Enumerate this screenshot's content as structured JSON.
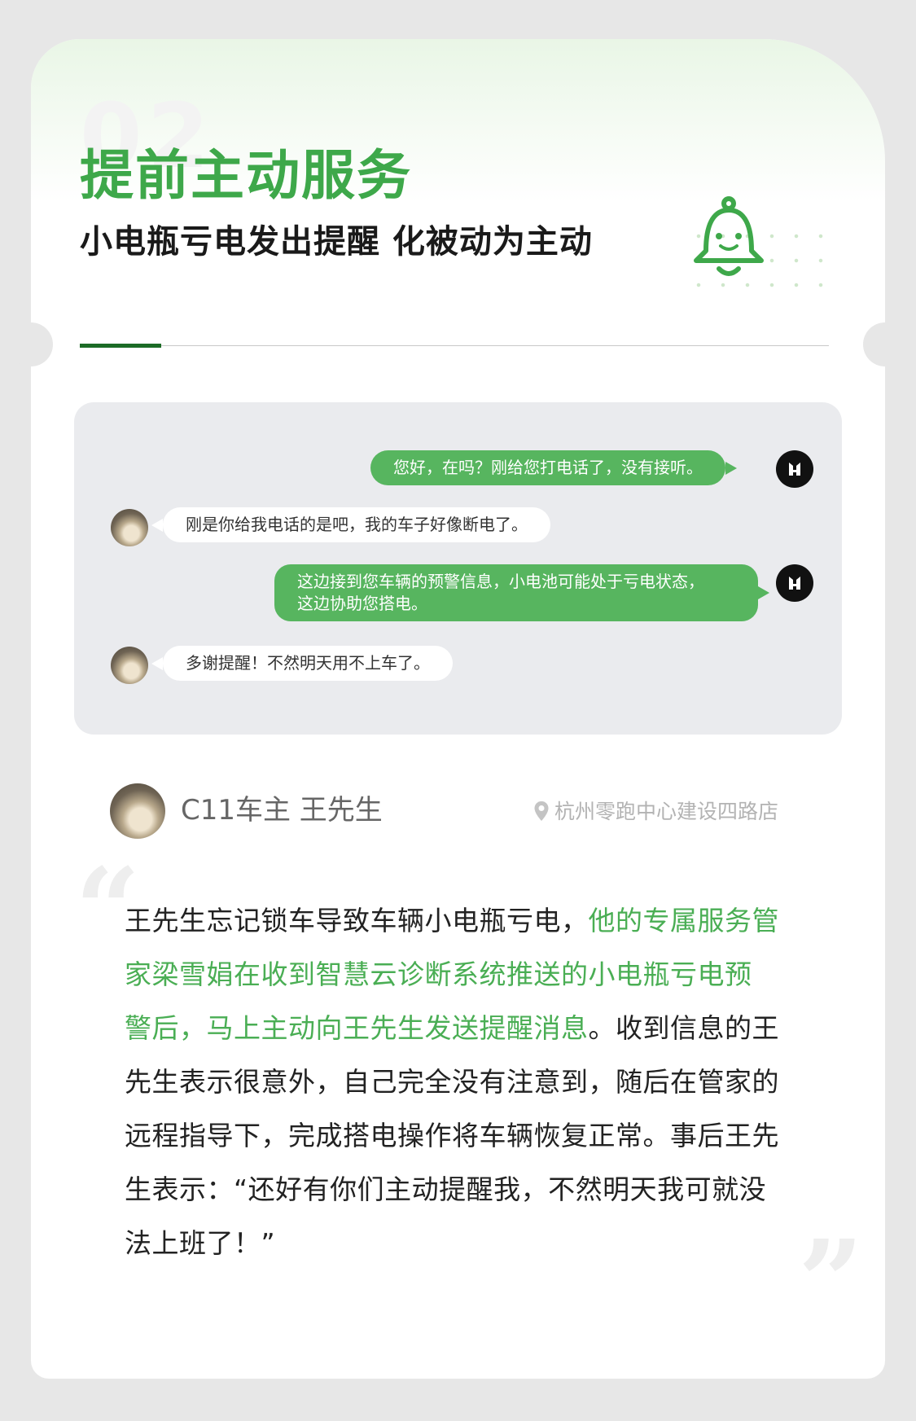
{
  "header": {
    "section_number": "02",
    "title": "提前主动服务",
    "subtitle": "小电瓶亏电发出提醒 化被动为主动"
  },
  "chat": {
    "messages": [
      {
        "from": "agent",
        "text": "您好，在吗？刚给您打电话了，没有接听。"
      },
      {
        "from": "user",
        "text": "刚是你给我电话的是吧，我的车子好像断电了。"
      },
      {
        "from": "agent",
        "lines": [
          "这边接到您车辆的预警信息，小电池可能处于亏电状态，",
          "这边协助您搭电。"
        ]
      },
      {
        "from": "user",
        "text": "多谢提醒！不然明天用不上车了。"
      }
    ]
  },
  "profile": {
    "name": "C11车主 王先生",
    "location": "杭州零跑中心建设四路店"
  },
  "story": {
    "open_quote": "“",
    "close_quote": "”",
    "lines": [
      {
        "a": "王先生忘记锁车导致车辆小电瓶亏电，",
        "b": "他的专属服务管"
      },
      {
        "a": "",
        "b": "家梁雪娟在收到智慧云诊断系统推送的小电瓶亏电预"
      },
      {
        "a": "",
        "b": "警后，马上主动向王先生发送提醒消息",
        "c": "。收到信息的王"
      },
      {
        "a": "先生表示很意外，自己完全没有注意到，随后在管家的"
      },
      {
        "a": "远程指导下，完成搭电操作将车辆恢复正常。事后王先"
      },
      {
        "a": "生表示：“还好有你们主动提醒我，不然明天我可就没"
      },
      {
        "a": "法上班了！”"
      }
    ]
  },
  "colors": {
    "accent_green": "#3ea84a",
    "bubble_green": "#57b55f",
    "divider_dark_green": "#1c6b26",
    "background": "#e7e7e7"
  },
  "icons": [
    "bell-icon",
    "location-pin-icon",
    "brand-logo-icon"
  ]
}
